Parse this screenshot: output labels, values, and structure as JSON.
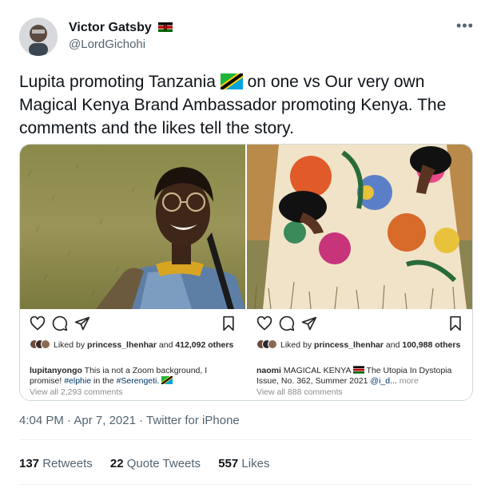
{
  "user": {
    "name": "Victor Gatsby",
    "handle": "@LordGichohi"
  },
  "tweet": {
    "text_before_flag": "Lupita promoting Tanzania",
    "text_after_flag": " on one vs Our very own Magical Kenya Brand Ambassador promoting Kenya. The comments and the likes tell the story."
  },
  "left_post": {
    "liked_by_prefix": "Liked by",
    "liked_by_user": "princess_lhenhar",
    "liked_by_suffix": "and",
    "likes_count": "412,092 others",
    "caption_user": "lupitanyongo",
    "caption_text_1": "This ia not a Zoom background, I promise!",
    "caption_hash_1": "#elphie",
    "caption_text_2": "in the",
    "caption_hash_2": "#Serengeti.",
    "view_all": "View all 2,293 comments"
  },
  "right_post": {
    "liked_by_prefix": "Liked by",
    "liked_by_user": "princess_lhenhar",
    "liked_by_suffix": "and",
    "likes_count": "100,988 others",
    "caption_user": "naomi",
    "caption_text_1": "MAGICAL KENYA",
    "caption_text_2": "The Utopia In Dystopia Issue, No. 362, Summer 2021",
    "caption_mention": "@i_d...",
    "caption_more": "more",
    "view_all": "View all 888 comments"
  },
  "meta": {
    "time": "4:04 PM",
    "sep1": "·",
    "date": "Apr 7, 2021",
    "sep2": "·",
    "source": "Twitter for iPhone"
  },
  "stats": {
    "retweets_count": "137",
    "retweets_label": "Retweets",
    "quotes_count": "22",
    "quotes_label": "Quote Tweets",
    "likes_count": "557",
    "likes_label": "Likes"
  },
  "colors": {
    "text": "#0f1419",
    "muted": "#536471",
    "kenya_flag": [
      "#000000",
      "#bb0000",
      "#006600",
      "#ffffff"
    ],
    "tanzania_flag": [
      "#1eb53a",
      "#00a3dd",
      "#fcd116",
      "#000000"
    ]
  },
  "icons": [
    "more-dots-icon",
    "kenya-flag-icon",
    "tanzania-flag-icon",
    "heart-icon",
    "comment-icon",
    "share-icon",
    "bookmark-icon"
  ]
}
